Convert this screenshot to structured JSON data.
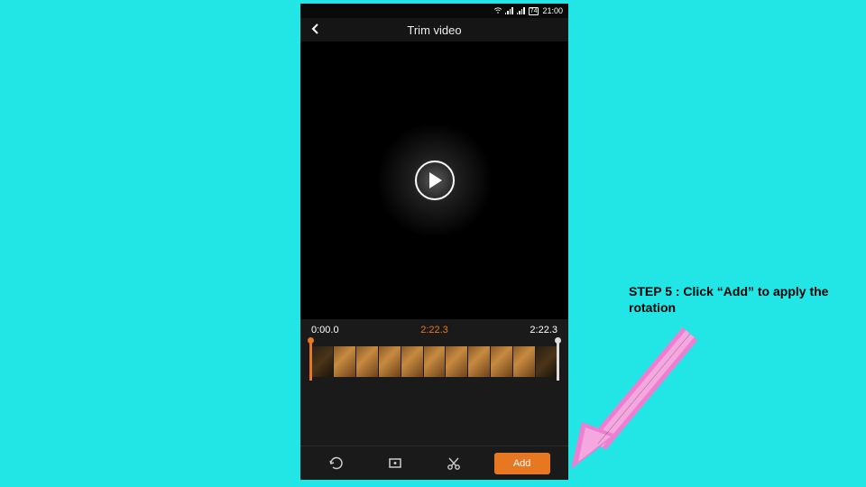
{
  "status": {
    "battery_label": "74",
    "clock": "21:00"
  },
  "header": {
    "title": "Trim video"
  },
  "times": {
    "start": "0:00.0",
    "current": "2:22.3",
    "end": "2:22.3"
  },
  "toolbar": {
    "rotate_label": "Rotate",
    "crop_label": "Crop",
    "cut_label": "Cut",
    "add_label": "Add"
  },
  "instruction": {
    "text": "STEP 5 : Click “Add” to apply the rotation"
  }
}
